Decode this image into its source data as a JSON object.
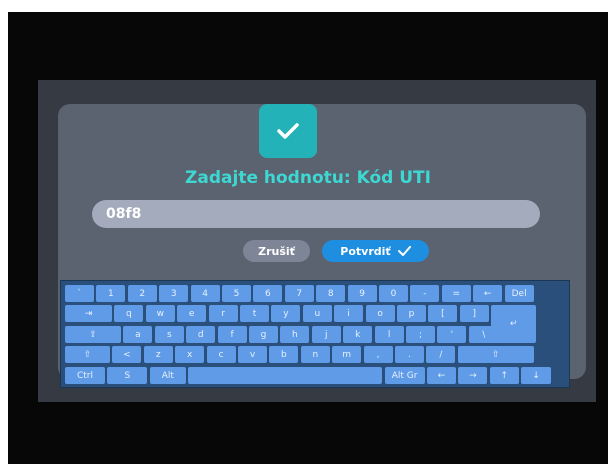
{
  "dialog": {
    "title": "Zadajte hodnotu: Kód UTI",
    "value": "08f8",
    "cancel_label": "Zrušiť",
    "confirm_label": "Potvrdiť",
    "icon": "check-icon"
  },
  "keyboard": {
    "rows": [
      [
        "`",
        "1",
        "2",
        "3",
        "4",
        "5",
        "6",
        "7",
        "8",
        "9",
        "0",
        "-",
        "=",
        "←",
        "Del"
      ],
      [
        "⇥",
        "q",
        "w",
        "e",
        "r",
        "t",
        "y",
        "u",
        "i",
        "o",
        "p",
        "[",
        "]",
        "↵"
      ],
      [
        "⇪",
        "a",
        "s",
        "d",
        "f",
        "g",
        "h",
        "j",
        "k",
        "l",
        ";",
        "'",
        "\\"
      ],
      [
        "⇧",
        "<",
        "z",
        "x",
        "c",
        "v",
        "b",
        "n",
        "m",
        ",",
        ".",
        "/",
        "⇧"
      ],
      [
        "Ctrl",
        "S",
        "Alt",
        "",
        "Alt Gr",
        "←",
        "→",
        "↑",
        "↓"
      ]
    ]
  },
  "colors": {
    "accent": "#22b2b8",
    "title": "#3ed8d2",
    "confirm": "#1e8fe0",
    "key": "#5f9be6",
    "keyboard_bg": "#2b4f7b"
  }
}
